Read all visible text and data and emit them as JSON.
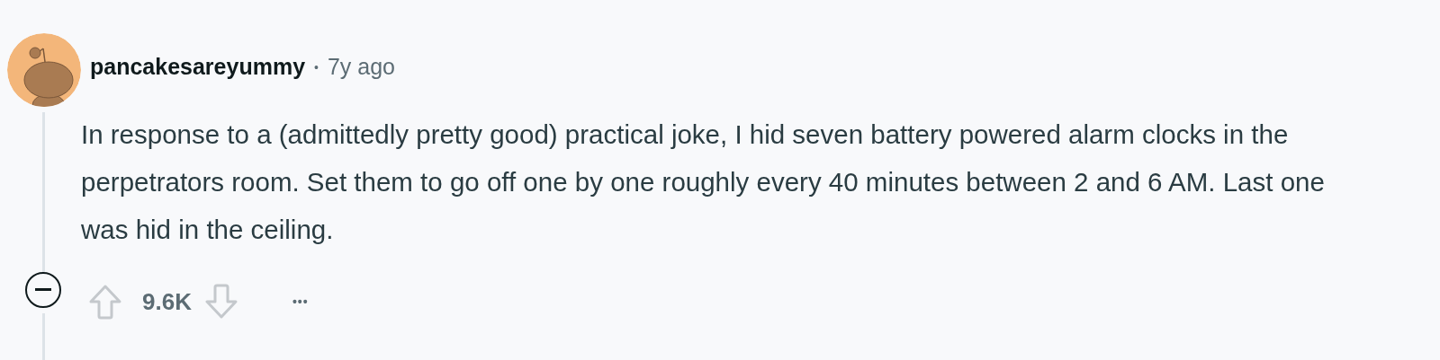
{
  "comment": {
    "author": "pancakesareyummy",
    "separator": "•",
    "time": "7y ago",
    "body": "In response to a (admittedly pretty good) practical joke, I hid seven battery powered alarm clocks in the perpetrators room. Set them to go off one by one roughly every 40 minutes between 2 and 6 AM. Last one was hid in the ceiling.",
    "score": "9.6K",
    "more": "•••"
  }
}
